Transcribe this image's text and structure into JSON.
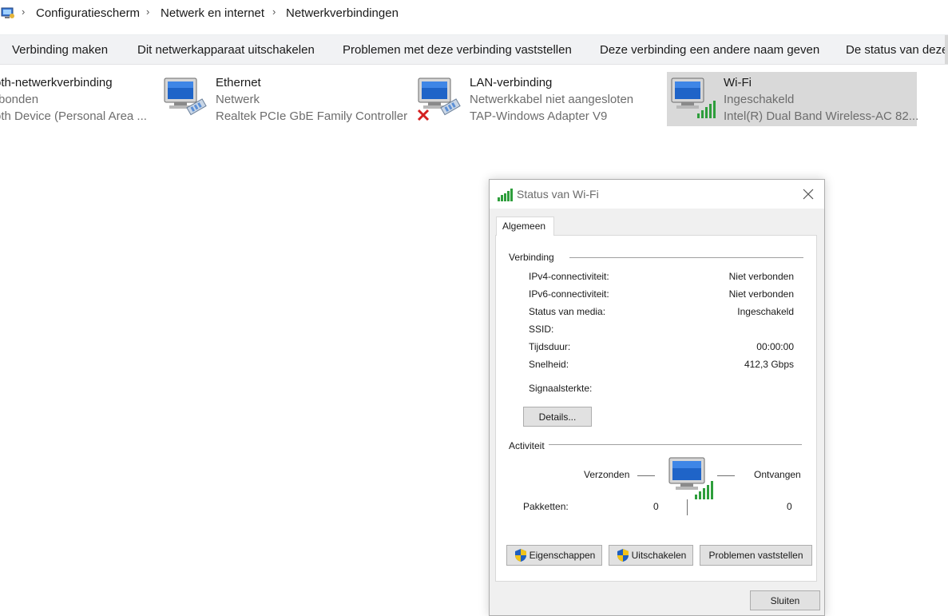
{
  "breadcrumb": {
    "items": [
      "Configuratiescherm",
      "Netwerk en internet",
      "Netwerkverbindingen"
    ],
    "icon": "control-panel-icon"
  },
  "toolbar": {
    "buttons": [
      "Verbinding maken",
      "Dit netwerkapparaat uitschakelen",
      "Problemen met deze verbinding vaststellen",
      "Deze verbinding een andere naam geven",
      "De status van deze"
    ]
  },
  "connections": [
    {
      "name": "oth-netwerkverbinding",
      "status": "rbonden",
      "device": "oth Device (Personal Area ...",
      "icon": "bluetooth-network-icon"
    },
    {
      "name": "Ethernet",
      "status": "Netwerk",
      "device": "Realtek PCIe GbE Family Controller",
      "icon": "ethernet-network-icon"
    },
    {
      "name": "LAN-verbinding",
      "status": "Netwerkkabel niet aangesloten",
      "device": "TAP-Windows Adapter V9",
      "icon": "lan-disconnected-icon"
    },
    {
      "name": "Wi-Fi",
      "status": "Ingeschakeld",
      "device": "Intel(R) Dual Band Wireless-AC 82...",
      "icon": "wifi-network-icon"
    }
  ],
  "dialog": {
    "title": "Status van Wi-Fi",
    "tab": "Algemeen",
    "connection_group": "Verbinding",
    "rows": [
      {
        "label": "IPv4-connectiviteit:",
        "value": "Niet verbonden"
      },
      {
        "label": "IPv6-connectiviteit:",
        "value": "Niet verbonden"
      },
      {
        "label": "Status van media:",
        "value": "Ingeschakeld"
      },
      {
        "label": "SSID:",
        "value": ""
      },
      {
        "label": "Tijdsduur:",
        "value": "00:00:00"
      },
      {
        "label": "Snelheid:",
        "value": "412,3 Gbps"
      }
    ],
    "signal_label": "Signaalsterkte:",
    "details_button": "Details...",
    "activity_group": "Activiteit",
    "sent_label": "Verzonden",
    "received_label": "Ontvangen",
    "packets_label": "Pakketten:",
    "packets_sent": "0",
    "packets_received": "0",
    "properties_button": "Eigenschappen",
    "disable_button": "Uitschakelen",
    "diagnose_button": "Problemen vaststellen",
    "close_button": "Sluiten"
  },
  "colors": {
    "selected_bg": "#d9d9d9",
    "toolbar_bg": "#f1f2f4",
    "signal_green": "#2e9e3c",
    "monitor_blue": "#1f64c8"
  }
}
